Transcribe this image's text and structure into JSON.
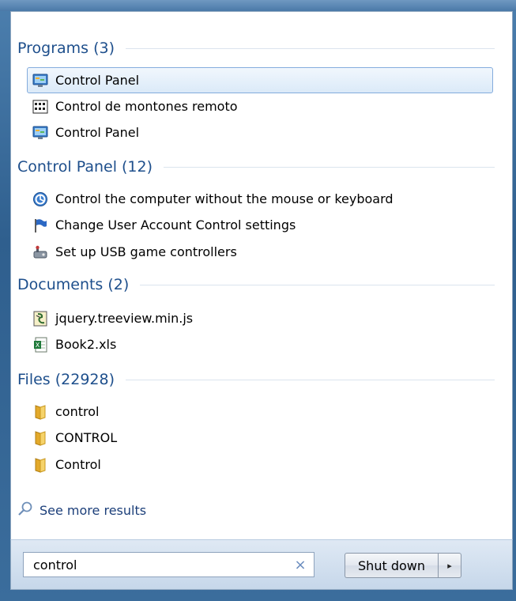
{
  "groups": [
    {
      "title": "Programs (3)",
      "items": [
        {
          "label": "Control Panel",
          "icon": "control-panel-icon",
          "selected": true
        },
        {
          "label": "Control de montones remoto",
          "icon": "remote-control-icon"
        },
        {
          "label": "Control Panel",
          "icon": "control-panel-icon"
        }
      ]
    },
    {
      "title": "Control Panel (12)",
      "items": [
        {
          "label": "Control the computer without the mouse or keyboard",
          "icon": "ease-of-access-icon"
        },
        {
          "label": "Change User Account Control settings",
          "icon": "uac-flag-icon"
        },
        {
          "label": "Set up USB game controllers",
          "icon": "game-controller-icon"
        }
      ]
    },
    {
      "title": "Documents (2)",
      "items": [
        {
          "label": "jquery.treeview.min.js",
          "icon": "script-file-icon"
        },
        {
          "label": "Book2.xls",
          "icon": "excel-file-icon"
        }
      ]
    },
    {
      "title": "Files (22928)",
      "items": [
        {
          "label": "control",
          "icon": "folder-icon"
        },
        {
          "label": "CONTROL",
          "icon": "folder-icon"
        },
        {
          "label": "Control",
          "icon": "folder-icon"
        }
      ]
    }
  ],
  "see_more": {
    "label": "See more results",
    "icon": "search-icon"
  },
  "search": {
    "value": "control",
    "clear_icon": "×"
  },
  "shutdown": {
    "label": "Shut down",
    "arrow_icon": "▸"
  },
  "colors": {
    "group_title": "#1e4f8c",
    "selected_border": "#84acdd"
  }
}
